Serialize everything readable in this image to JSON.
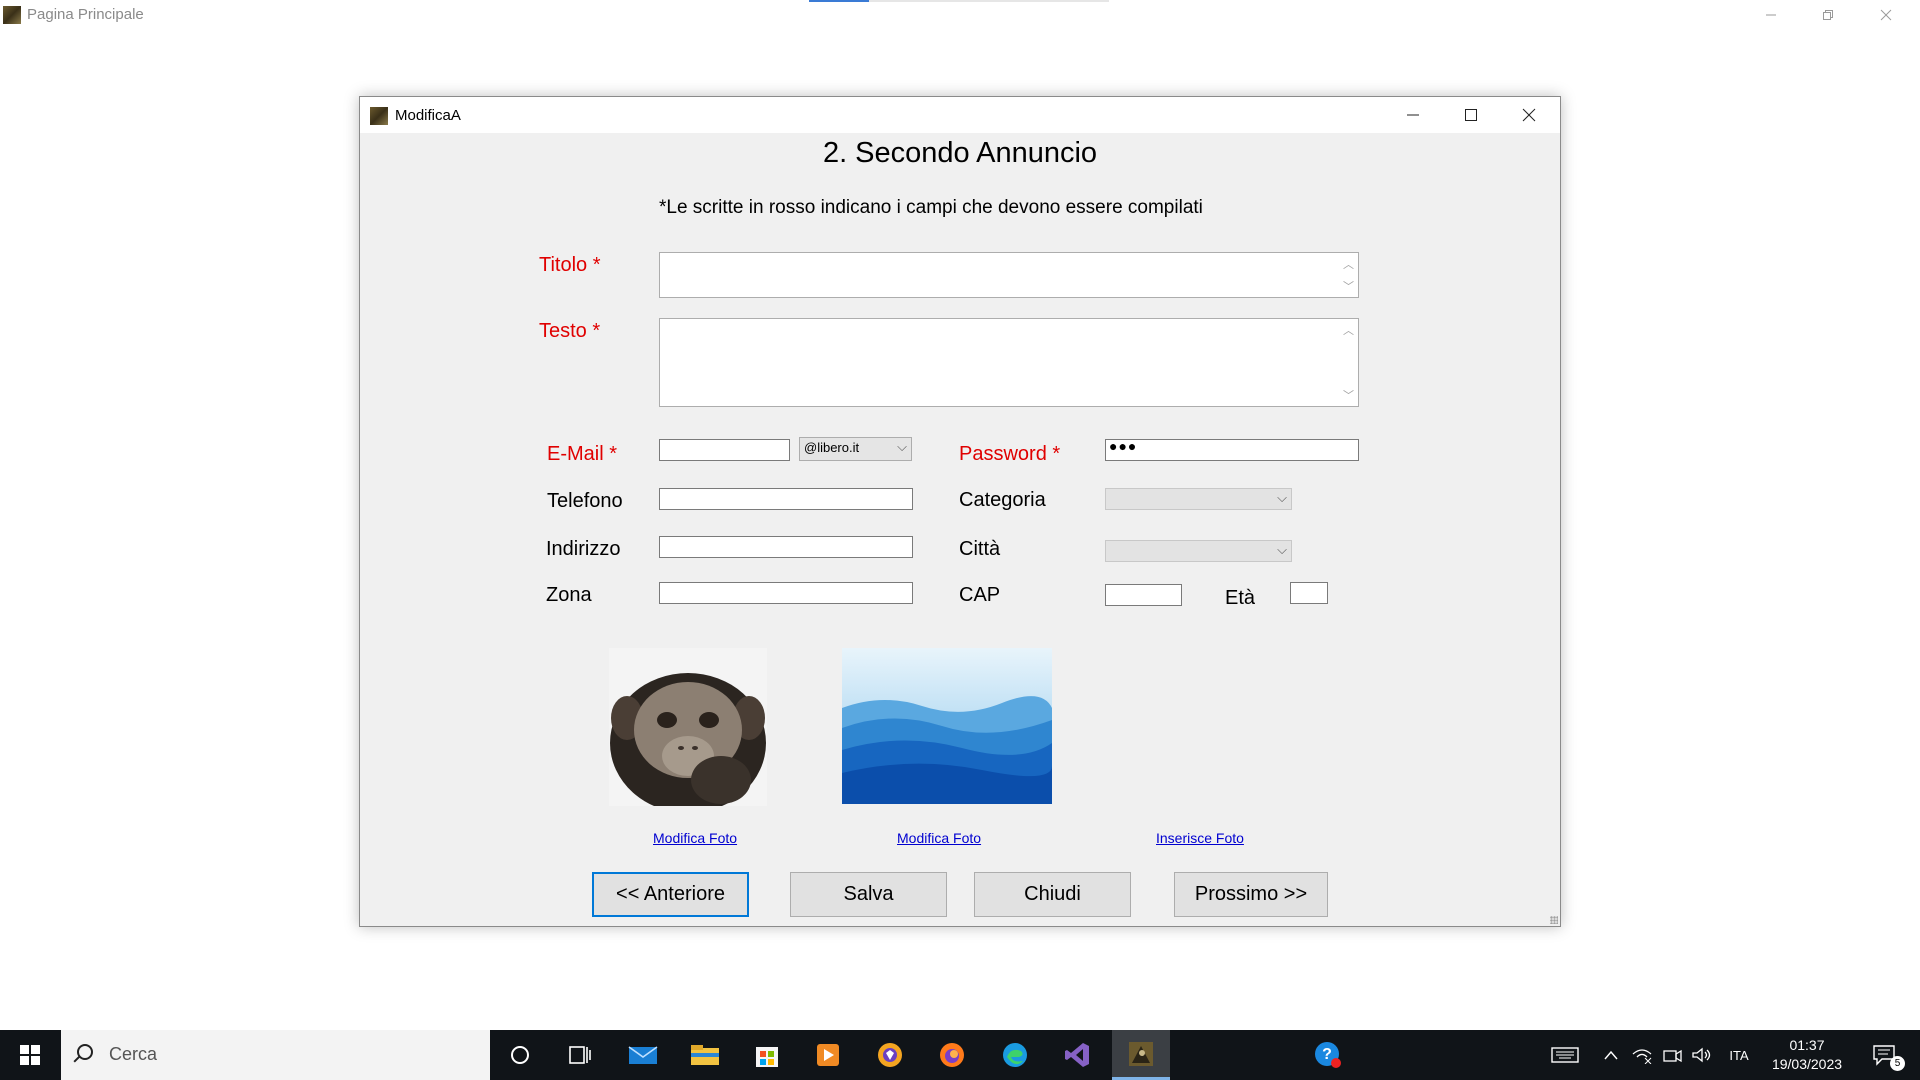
{
  "main_window": {
    "title": "Pagina Principale",
    "icon": "app-icon",
    "controls": [
      "minimize-icon",
      "restore-icon",
      "close-icon"
    ]
  },
  "dialog": {
    "title": "ModificaA",
    "heading": "2. Secondo Annuncio",
    "note": "*Le scritte in rosso indicano i campi che devono essere compilati",
    "fields": {
      "titolo": {
        "label": "Titolo *",
        "value": ""
      },
      "testo": {
        "label": "Testo *",
        "value": ""
      },
      "email": {
        "label": "E-Mail *",
        "value": "",
        "domain": "@libero.it"
      },
      "password": {
        "label": "Password *",
        "masked_value": "●●●"
      },
      "telefono": {
        "label": "Telefono",
        "value": ""
      },
      "categoria": {
        "label": "Categoria",
        "value": ""
      },
      "indirizzo": {
        "label": "Indirizzo",
        "value": ""
      },
      "citta": {
        "label": "Città",
        "value": ""
      },
      "zona": {
        "label": "Zona",
        "value": ""
      },
      "cap": {
        "label": "CAP",
        "value": ""
      },
      "eta": {
        "label": "Età",
        "value": ""
      }
    },
    "photos": [
      {
        "link": "Modifica Foto",
        "image": "chimp-photo"
      },
      {
        "link": "Modifica Foto",
        "image": "mountains-photo"
      },
      {
        "link": "Inserisce Foto",
        "image": ""
      }
    ],
    "buttons": {
      "previous": "<< Anteriore",
      "save": "Salva",
      "close": "Chiudi",
      "next": "Prossimo >>"
    }
  },
  "taskbar": {
    "search_placeholder": "Cerca",
    "apps": [
      "cortana-icon",
      "task-view-icon",
      "mail-icon",
      "file-explorer-icon",
      "store-icon",
      "media-player-icon",
      "brave-icon",
      "firefox-icon",
      "edge-icon",
      "visual-studio-icon",
      "app-icon",
      "help-icon"
    ],
    "tray": {
      "language": "ITA",
      "time": "01:37",
      "date": "19/03/2023",
      "notifications": "5"
    }
  },
  "colors": {
    "required_label": "#e00000",
    "link": "#0000d0",
    "dialog_bg": "#f0f0f0",
    "taskbar_bg": "#101418",
    "focus_border": "#0078d7"
  }
}
